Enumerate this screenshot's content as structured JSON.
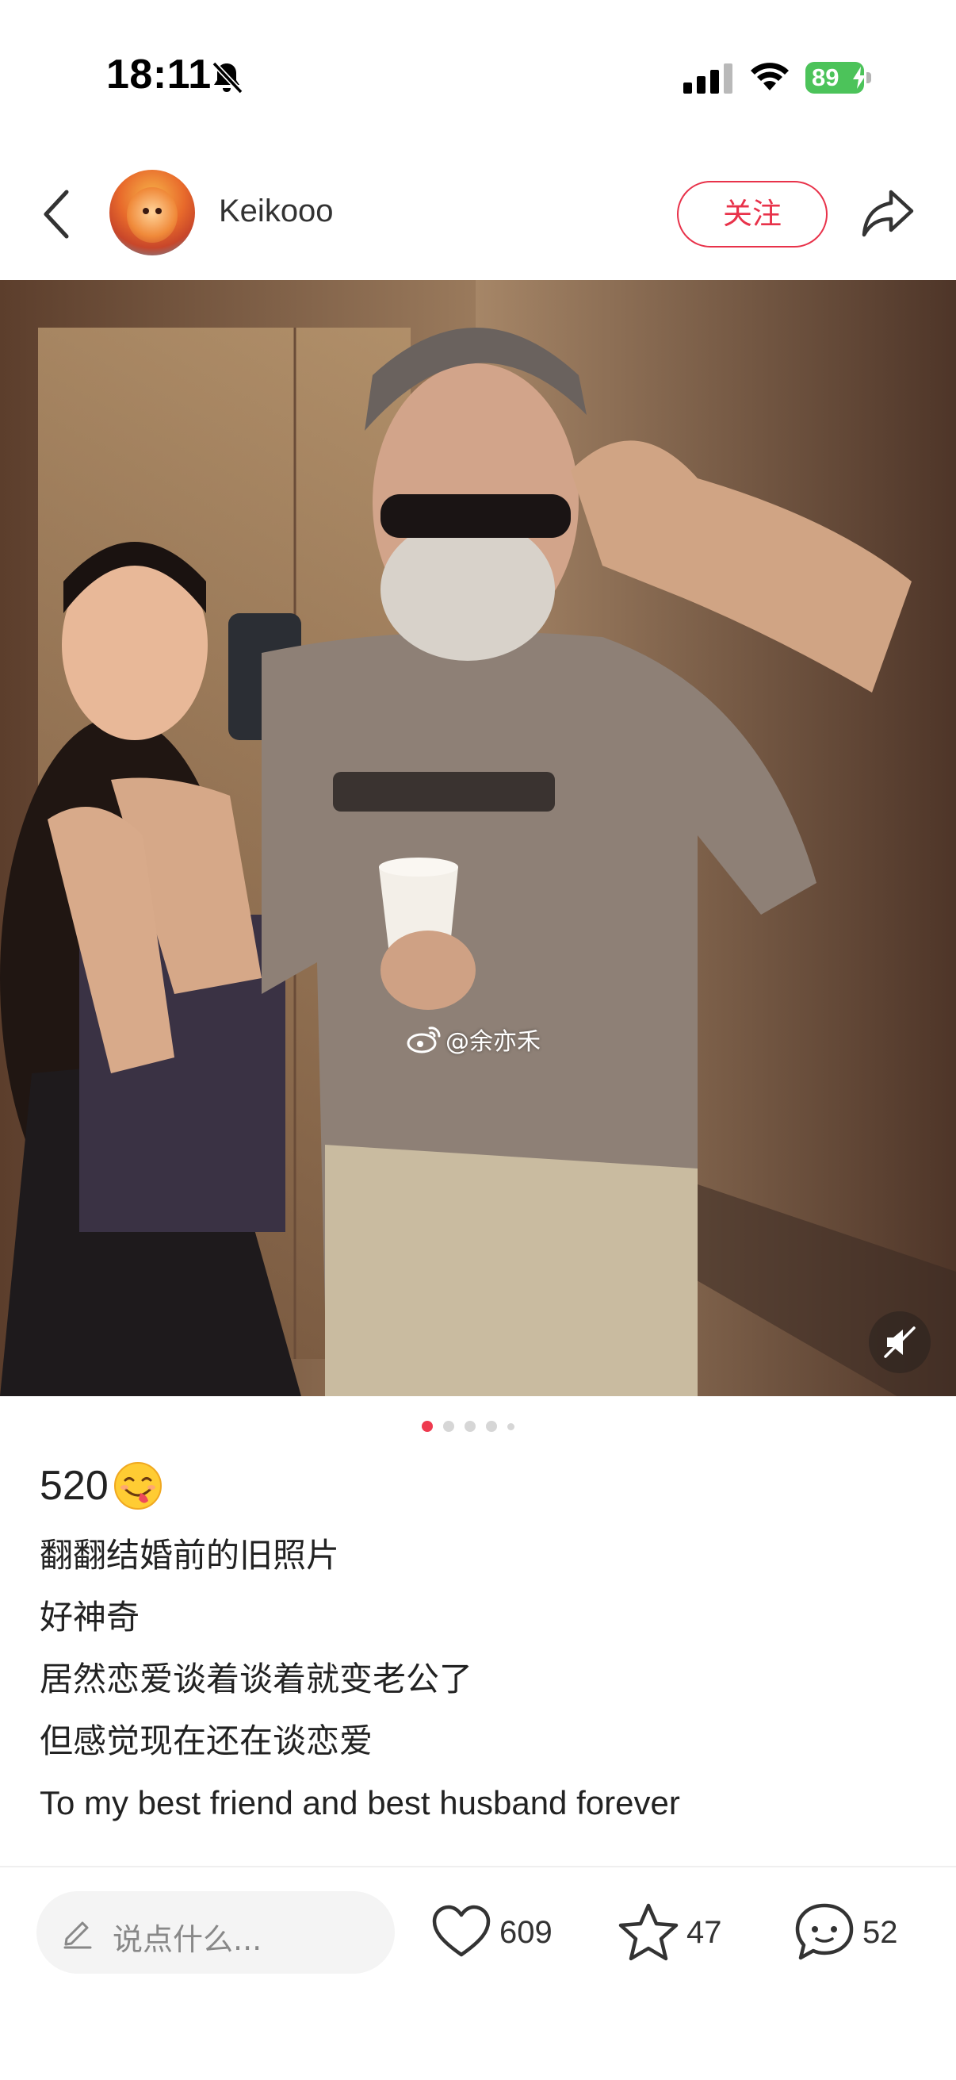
{
  "status_bar": {
    "time": "18:11",
    "battery": "89"
  },
  "header": {
    "username": "Keikooo",
    "follow_label": "关注"
  },
  "photo": {
    "watermark": "@余亦禾"
  },
  "pagination": {
    "total_dots": 5,
    "active_index": 0
  },
  "caption": {
    "title": "520",
    "lines": [
      "翻翻结婚前的旧照片",
      "好神奇",
      "居然恋爱谈着谈着就变老公了",
      "但感觉现在还在谈恋爱",
      "To my best friend and best husband forever"
    ]
  },
  "bottom_bar": {
    "comment_placeholder": "说点什么...",
    "likes": "609",
    "collects": "47",
    "comments": "52"
  },
  "colors": {
    "accent": "#e8324a",
    "active_dot": "#ee3a4f",
    "battery_green": "#4cc35a"
  }
}
